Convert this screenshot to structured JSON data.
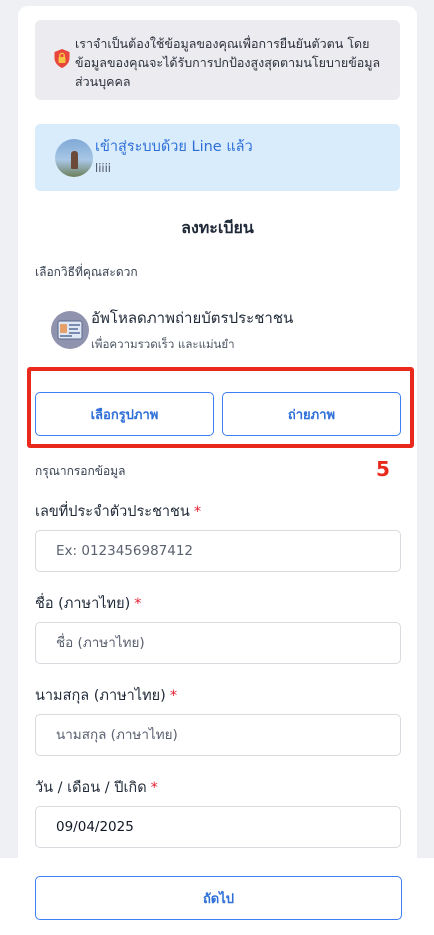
{
  "notice": {
    "text": "เราจำเป็นต้องใช้ข้อมูลของคุณเพื่อการยืนยันตัวตน โดยข้อมูลของคุณจะได้รับการปกป้องสูงสุดตามนโยบายข้อมูลส่วนบุคคล",
    "icon": "shield-lock-icon"
  },
  "line_login": {
    "title": "เข้าสู่ระบบด้วย Line แล้ว",
    "username": "liiii"
  },
  "register": {
    "title": "ลงทะเบียน",
    "choose_method": "เลือกวิธีที่คุณสะดวก",
    "upload_title": "อัพโหลดภาพถ่ายบัตรประชาชน",
    "upload_subtitle": "เพื่อความรวดเร็ว และแม่นยำ",
    "choose_image_button": "เลือกรูปภาพ",
    "take_photo_button": "ถ่ายภาพ"
  },
  "annotation": {
    "number": "5",
    "color": "#e8291c"
  },
  "form": {
    "section_label": "กรุณากรอกข้อมูล",
    "required_mark": "*",
    "id_label": "เลขที่ประจำตัวประชาชน",
    "id_placeholder": "Ex: 0123456987412",
    "first_name_label": "ชื่อ (ภาษาไทย)",
    "first_name_placeholder": "ชื่อ (ภาษาไทย)",
    "last_name_label": "นามสกุล (ภาษาไทย)",
    "last_name_placeholder": "นามสกุล (ภาษาไทย)",
    "dob_label": "วัน / เดือน / ปีเกิด",
    "dob_value": "09/04/2025"
  },
  "footer": {
    "next_button": "ถัดไป"
  },
  "colors": {
    "accent": "#2e6fd8",
    "line_box": "#d9ecfc",
    "required": "#e11d2e"
  }
}
